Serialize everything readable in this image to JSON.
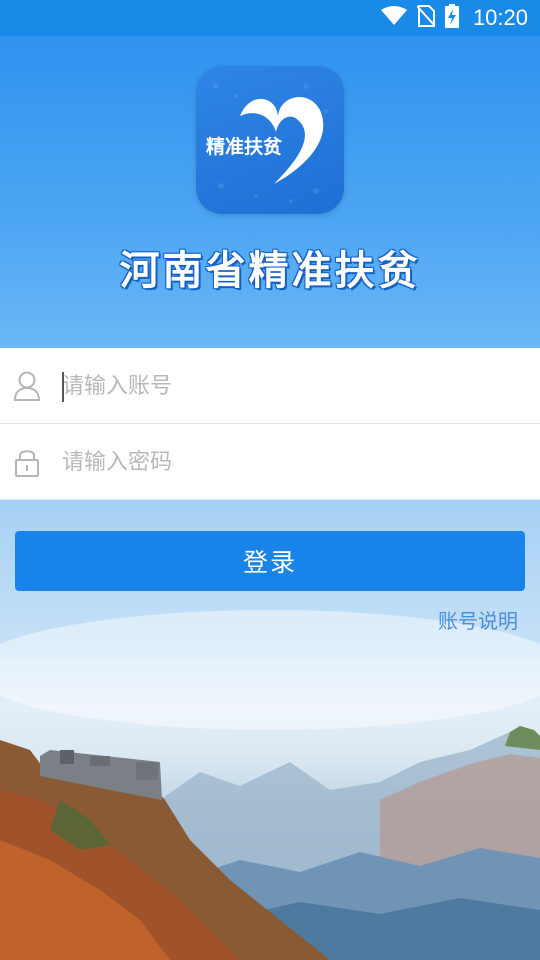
{
  "status_bar": {
    "time": "10:20",
    "icons": [
      "wifi-icon",
      "no-sim-icon",
      "battery-charging-icon"
    ]
  },
  "header": {
    "logo_text": "精准扶贫",
    "app_title": "河南省精准扶贫"
  },
  "login_form": {
    "username_placeholder": "请输入账号",
    "password_placeholder": "请输入密码",
    "username_icon": "user-icon",
    "password_icon": "lock-icon"
  },
  "actions": {
    "login_label": "登录",
    "account_help_label": "账号说明"
  },
  "colors": {
    "status_bar": "#1a8ae8",
    "primary_button": "#1883e8",
    "link": "#4a8fd6",
    "header_top": "#2f93ef"
  }
}
